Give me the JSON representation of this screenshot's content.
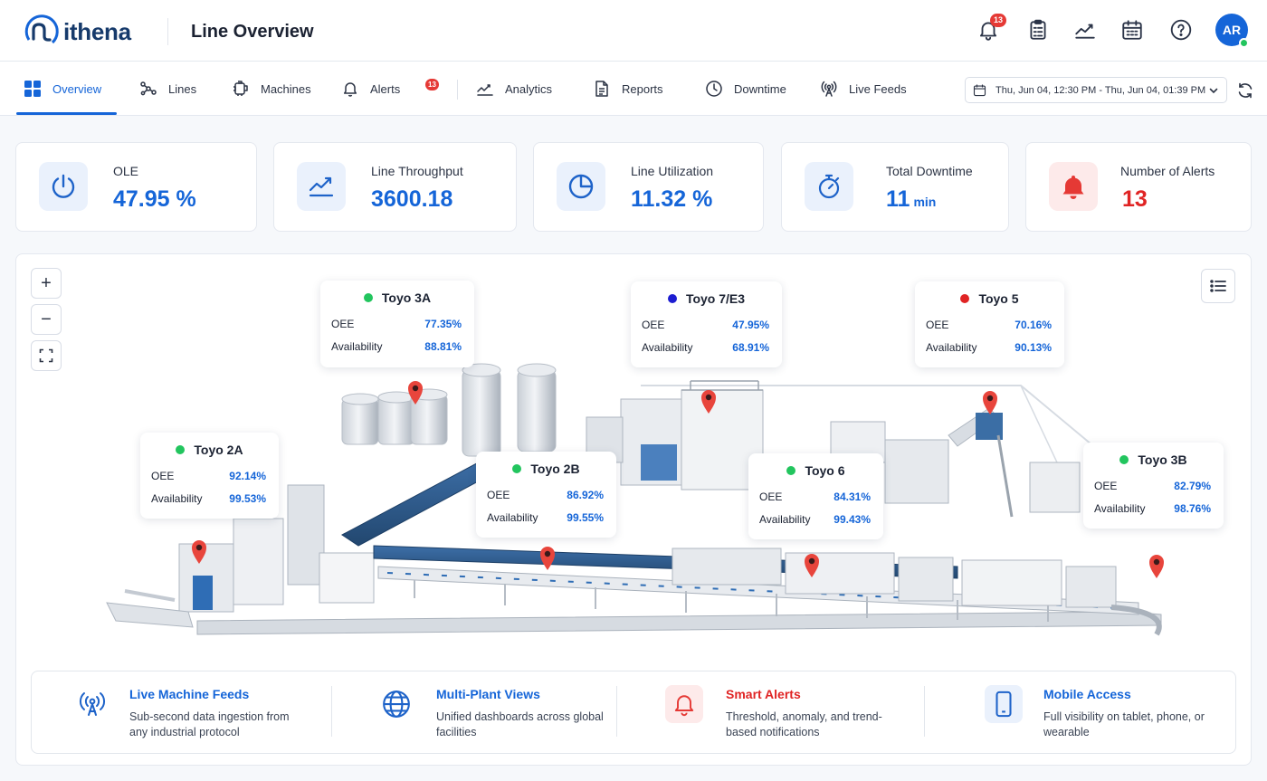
{
  "header": {
    "logo_text": "ithena",
    "page_title": "Line Overview",
    "notification_count": "13",
    "avatar_initials": "AR",
    "icons": [
      "bell-icon",
      "clipboard-icon",
      "trend-chart-icon",
      "calendar-icon",
      "help-icon"
    ]
  },
  "nav": {
    "tabs": [
      {
        "label": "Overview",
        "icon": "grid-icon"
      },
      {
        "label": "Lines",
        "icon": "nodes-icon"
      },
      {
        "label": "Machines",
        "icon": "robot-arm-icon"
      },
      {
        "label": "Alerts",
        "icon": "bell-icon"
      },
      {
        "label": "Analytics",
        "icon": "line-chart-icon"
      },
      {
        "label": "Reports",
        "icon": "document-icon"
      },
      {
        "label": "Downtime",
        "icon": "clock-icon"
      },
      {
        "label": "Live Feeds",
        "icon": "broadcast-icon"
      }
    ],
    "active_tab": "Overview",
    "alerts_badge": "13",
    "date_range": "Thu, Jun 04, 12:30 PM - Thu, Jun 04, 01:39 PM"
  },
  "kpis": [
    {
      "label": "OLE",
      "value": "47.95 %",
      "unit": "",
      "icon": "gauge-icon"
    },
    {
      "label": "Line Throughput",
      "value": "3600.18",
      "unit": "",
      "icon": "trend-up-icon"
    },
    {
      "label": "Line Utilization",
      "value": "11.32 %",
      "unit": "",
      "icon": "pie-icon"
    },
    {
      "label": "Total Downtime",
      "value": "11",
      "unit": "min",
      "icon": "stopwatch-icon"
    },
    {
      "label": "Number of Alerts",
      "value": "13",
      "unit": "",
      "icon": "bell-icon"
    }
  ],
  "machines": [
    {
      "name": "Toyo 3A",
      "status_color": "#22c55e",
      "oee_label": "OEE",
      "oee": "77.35%",
      "availability_label": "Availability",
      "availability": "88.81%"
    },
    {
      "name": "Toyo 7/E3",
      "status_color": "#1d1dd1",
      "oee_label": "OEE",
      "oee": "47.95%",
      "availability_label": "Availability",
      "availability": "68.91%"
    },
    {
      "name": "Toyo 5",
      "status_color": "#e02424",
      "oee_label": "OEE",
      "oee": "70.16%",
      "availability_label": "Availability",
      "availability": "90.13%"
    },
    {
      "name": "Toyo 2A",
      "status_color": "#22c55e",
      "oee_label": "OEE",
      "oee": "92.14%",
      "availability_label": "Availability",
      "availability": "99.53%"
    },
    {
      "name": "Toyo 2B",
      "status_color": "#22c55e",
      "oee_label": "OEE",
      "oee": "86.92%",
      "availability_label": "Availability",
      "availability": "99.55%"
    },
    {
      "name": "Toyo 6",
      "status_color": "#22c55e",
      "oee_label": "OEE",
      "oee": "84.31%",
      "availability_label": "Availability",
      "availability": "99.43%"
    },
    {
      "name": "Toyo 3B",
      "status_color": "#22c55e",
      "oee_label": "OEE",
      "oee": "82.79%",
      "availability_label": "Availability",
      "availability": "98.76%"
    }
  ],
  "map_controls": {
    "zoom_in": "+",
    "zoom_out": "−"
  },
  "features": [
    {
      "title": "Live Machine Feeds",
      "desc": "Sub-second data ingestion from any industrial protocol",
      "icon": "broadcast-icon"
    },
    {
      "title": "Multi-Plant Views",
      "desc": "Unified dashboards across global facilities",
      "icon": "globe-icon"
    },
    {
      "title": "Smart Alerts",
      "desc": "Threshold, anomaly, and trend-based notifications",
      "icon": "bell-icon"
    },
    {
      "title": "Mobile Access",
      "desc": "Full visibility on tablet, phone, or wearable",
      "icon": "mobile-icon"
    }
  ],
  "colors": {
    "accent": "#1565d8",
    "alert": "#e02424",
    "ok": "#22c55e"
  }
}
